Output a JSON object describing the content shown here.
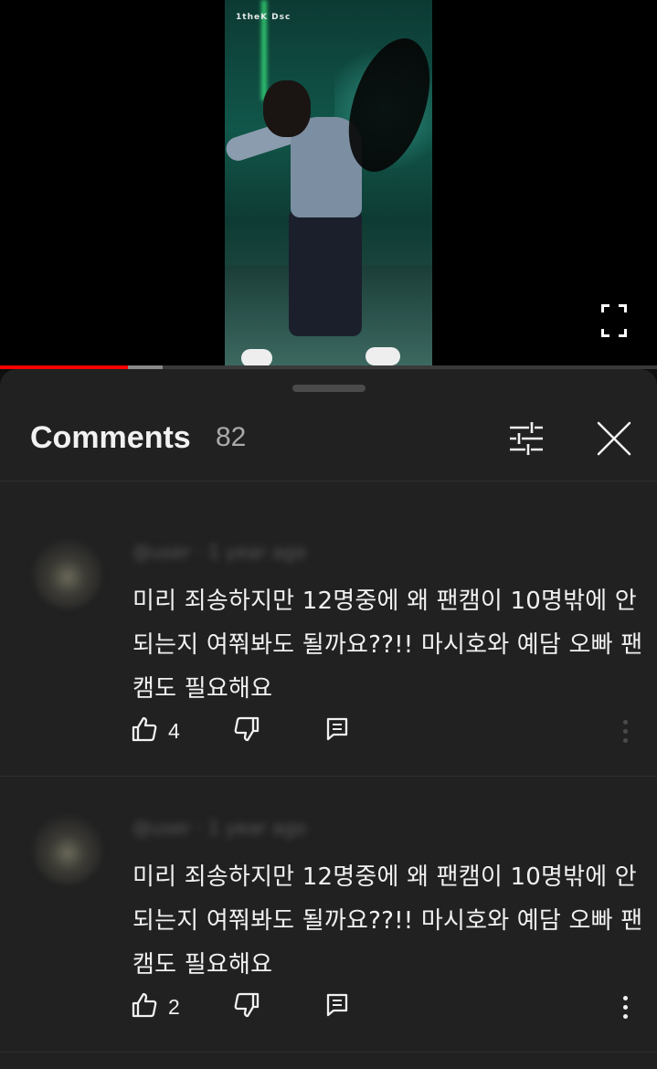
{
  "video": {
    "logo_text": "1theK Dsc"
  },
  "player": {
    "progress_played": 0.195,
    "progress_buffered": 0.248
  },
  "comments_panel": {
    "title": "Comments",
    "count": "82"
  },
  "comments": [
    {
      "author": "@user · 1 year ago",
      "text": "미리 죄송하지만 12명중에 왜 팬캠이 10명밖에 안되는지 여쭤봐도 될까요??!!  마시호와 예담 오빠 팬캠도 필요해요",
      "likes": "4"
    },
    {
      "author": "@user · 1 year ago",
      "text": "미리 죄송하지만 12명중에 왜 팬캠이 10명밖에 안되는지 여쭤봐도 될까요??!!  마시호와 예담 오빠 팬캠도 필요해요",
      "likes": "2"
    }
  ],
  "icons": {
    "filter": "sliders-icon",
    "close": "close-icon",
    "like": "thumbs-up-icon",
    "dislike": "thumbs-down-icon",
    "reply": "reply-icon",
    "more": "more-vert-icon",
    "fullscreen": "fullscreen-icon"
  },
  "colors": {
    "progress_played": "#ff0000",
    "sheet_background": "#212121"
  }
}
